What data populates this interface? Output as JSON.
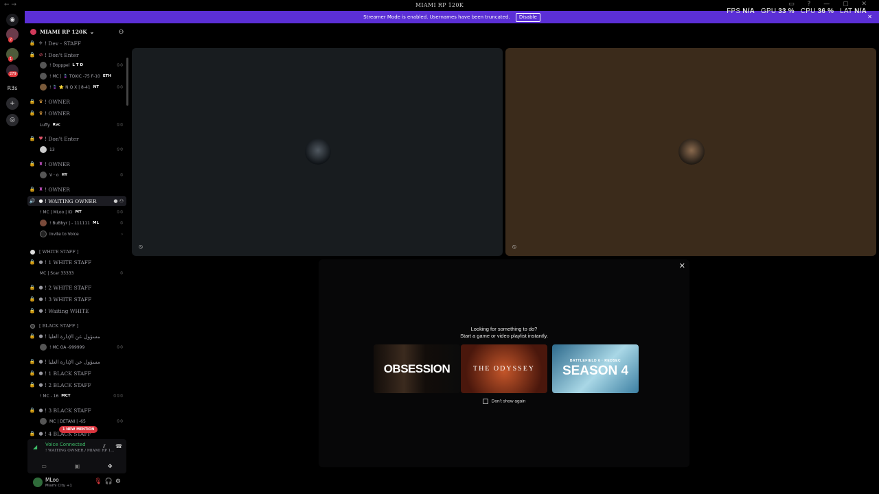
{
  "window": {
    "title": "MIAMI RP 120K"
  },
  "banner": {
    "message": "Streamer Mode is enabled. Usernames have been truncated.",
    "button": "Disable"
  },
  "stats": {
    "fps_label": "FPS",
    "fps": "N/A",
    "gpu_label": "GPU",
    "gpu": "33 %",
    "cpu_label": "CPU",
    "cpu": "36 %",
    "lat_label": "LAT",
    "lat": "N/A"
  },
  "guilds": {
    "badge1": "2",
    "badge2": "1",
    "badge3": "279",
    "text_server": "R3s"
  },
  "server": {
    "name": "MIAMI RP 120K"
  },
  "channels": {
    "c0": "! Dev - STAFF",
    "c1": "! Don't Enter",
    "c2": "! OWNER",
    "c3": "! OWNER",
    "c4": "! Don't Enter",
    "c5": "! OWNER",
    "c6": "! OWNER",
    "c7": "! WAITING OWNER",
    "c8": "! 1 WHITE STAFF",
    "c9": "! 2 WHITE STAFF",
    "c10": "! 3 WHITE STAFF",
    "c11": "! Waiting WHITE",
    "c12": "! مسؤول عن الإدارة العليا",
    "c13": "! مسؤول عن الإدارة العليا",
    "c14": "! 1 BLACK STAFF",
    "c15": "! 2 BLACK STAFF",
    "c16": "! 3 BLACK STAFF",
    "c17": "! 4 BLACK STAFF"
  },
  "categories": {
    "white": "[ WHITE STAFF ]",
    "black": "[ BLACK STAFF ]"
  },
  "users": {
    "u0": "! Dopppel",
    "u0tag": "L T D",
    "u1": "! MC | 🦹 TOXIC -75 F-10",
    "u1tag": "ETH",
    "u2": "! 🦹 ⭐ N Q X | 8-41",
    "u2tag": "NT",
    "u3": "Luffy",
    "u3tag": "Rvc",
    "u4": "13",
    "u5": "V · o",
    "u5tag": "HY",
    "u6": "! MC | MLoo | ID",
    "u6tag": "MT",
    "u7": "! BuBbyr | - 111111",
    "u7tag": "ML",
    "u8": "Invite to Voice",
    "u9": "MC | Scar 33333",
    "u10": "! MC OA -999999",
    "u11": "! MC - 16",
    "u11tag": "MCT",
    "u12": "MC | DETANI | -65"
  },
  "mention": "1 NEW MENTION",
  "voice": {
    "title": "Voice Connected",
    "sub": "! WAITING OWNER / MIAMI RP 1..."
  },
  "user": {
    "name": "MLoo",
    "status": "Miami City +1"
  },
  "activity": {
    "line1": "Looking for something to do?",
    "line2": "Start a game or video playlist instantly.",
    "card1": "OBSESSION",
    "card2": "THE ODYSSEY",
    "card3_small": "BATTLEFIELD 6 · REDSEC",
    "card3": "SEASON 4",
    "checkbox": "Don't show again"
  },
  "icons": {
    "lock": "lock-icon",
    "mic": "mic-off-icon",
    "close": "close-icon",
    "gear": "gear-icon",
    "headphones": "headphones-icon",
    "add-person": "add-person-icon"
  },
  "colors": {
    "banner": "#5b2fd6",
    "voice_green": "#3fbf6a",
    "mention_red": "#d8343d"
  }
}
